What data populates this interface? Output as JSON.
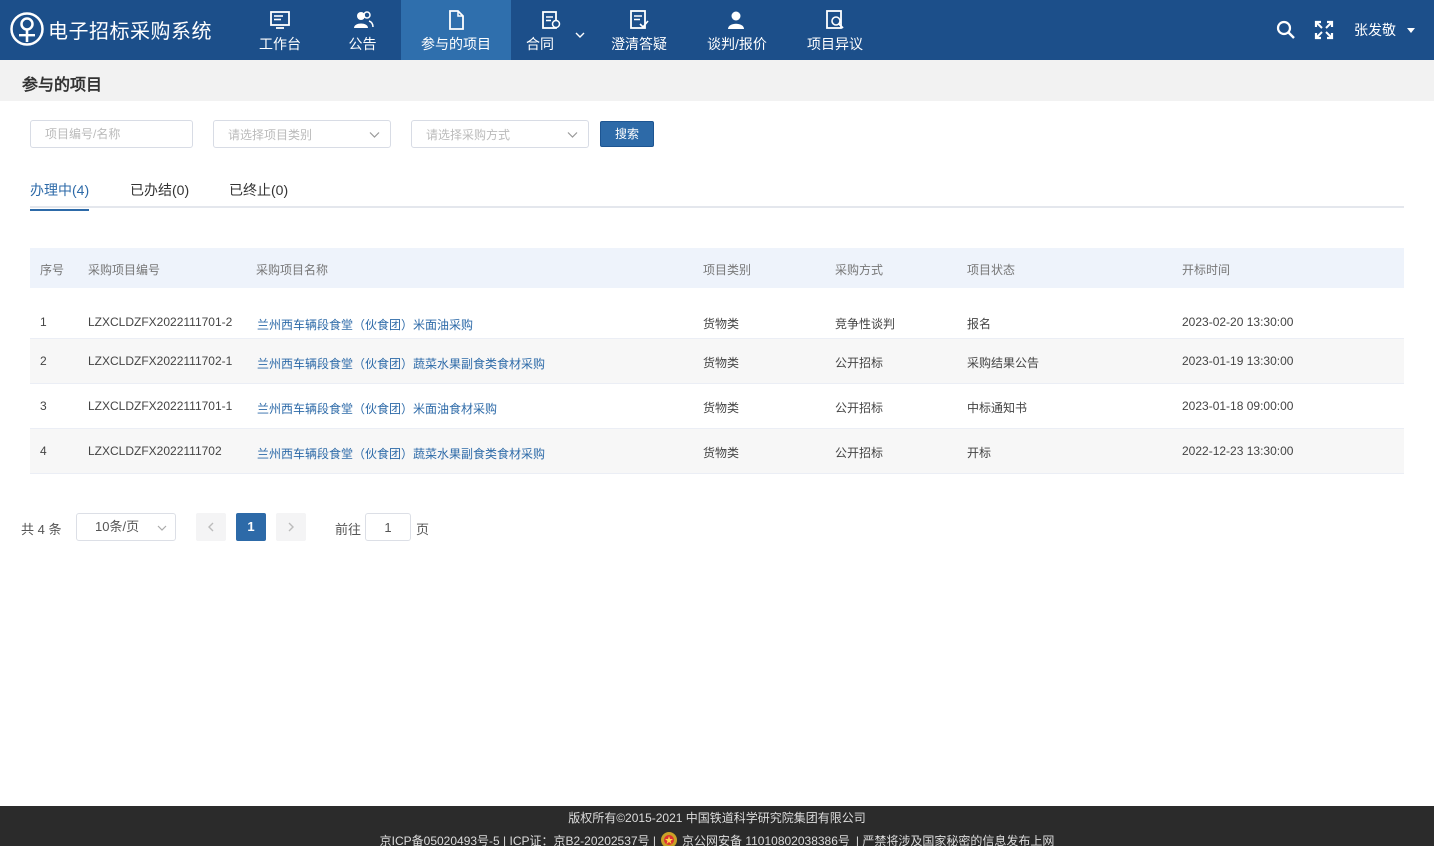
{
  "app": {
    "title": "电子招标采购系统"
  },
  "nav": [
    {
      "label": "工作台",
      "icon": "monitor-icon"
    },
    {
      "label": "公告",
      "icon": "users-icon"
    },
    {
      "label": "参与的项目",
      "icon": "document-icon",
      "active": true
    },
    {
      "label": "合同",
      "icon": "contract-icon",
      "has_dropdown": true
    },
    {
      "label": "澄清答疑",
      "icon": "clarify-icon"
    },
    {
      "label": "谈判/报价",
      "icon": "negotiate-icon"
    },
    {
      "label": "项目异议",
      "icon": "objection-icon"
    }
  ],
  "user": {
    "name": "张发敬"
  },
  "page": {
    "title": "参与的项目"
  },
  "filters": {
    "keyword_placeholder": "项目编号/名称",
    "category_placeholder": "请选择项目类别",
    "method_placeholder": "请选择采购方式",
    "search_label": "搜索"
  },
  "tabs": [
    {
      "label": "办理中(4)",
      "active": true
    },
    {
      "label": "已办结(0)"
    },
    {
      "label": "已终止(0)"
    }
  ],
  "table": {
    "headers": [
      "序号",
      "采购项目编号",
      "采购项目名称",
      "项目类别",
      "采购方式",
      "项目状态",
      "开标时间"
    ],
    "rows": [
      [
        "1",
        "LZXCLDZFX2022111701-2",
        "兰州西车辆段食堂（伙食团）米面油采购",
        "货物类",
        "竞争性谈判",
        "报名",
        "2023-02-20 13:30:00"
      ],
      [
        "2",
        "LZXCLDZFX2022111702-1",
        "兰州西车辆段食堂（伙食团）蔬菜水果副食类食材采购",
        "货物类",
        "公开招标",
        "采购结果公告",
        "2023-01-19 13:30:00"
      ],
      [
        "3",
        "LZXCLDZFX2022111701-1",
        "兰州西车辆段食堂（伙食团）米面油食材采购",
        "货物类",
        "公开招标",
        "中标通知书",
        "2023-01-18 09:00:00"
      ],
      [
        "4",
        "LZXCLDZFX2022111702",
        "兰州西车辆段食堂（伙食团）蔬菜水果副食类食材采购",
        "货物类",
        "公开招标",
        "开标",
        "2022-12-23 13:30:00"
      ]
    ]
  },
  "pagination": {
    "total_text": "共 4 条",
    "page_size": "10条/页",
    "current_page": "1",
    "goto_prefix": "前往",
    "goto_value": "1",
    "goto_suffix": "页"
  },
  "footer": {
    "copyright": "版权所有©2015-2021 中国铁道科学研究院集团有限公司",
    "icp": "京ICP备05020493号-5 | ICP证：京B2-20202537号 |",
    "police": "京公网安备 11010802038386号",
    "notice": "| 严禁将涉及国家秘密的信息发布上网"
  },
  "colors": {
    "topbar": "#1c4f8a",
    "active_nav": "#2f6fad",
    "accent": "#2d6aa8",
    "footer": "#2b2b2b"
  }
}
